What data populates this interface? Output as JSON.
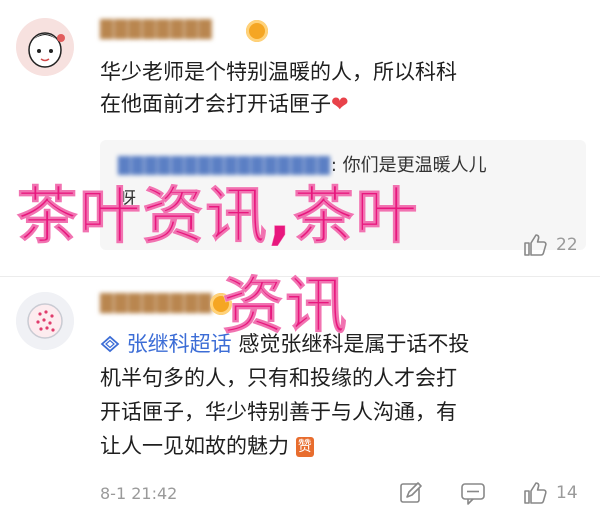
{
  "comment1": {
    "username": "████████",
    "text_line1": "华少老师是个特别温暖的人，所以科科",
    "text_line2": "在他面前才会打开话匣子",
    "heart": "❤",
    "quote_prefix": "████████████████",
    "quote_line1_suffix": ": 你们是更温暖人儿",
    "quote_line2": "呀",
    "like_count": "22"
  },
  "comment2": {
    "username": "████████",
    "link_label": "张继科超话",
    "text_line1_rest": " 感觉张继科是属于话不投",
    "text_line2": "机半句多的人，只有和投缘的人才会打",
    "text_line3": "开话匣子，华少特别善于与人沟通，有",
    "text_line4": "让人一见如故的魅力",
    "zan_emoji": "赞",
    "timestamp": "8-1 21:42",
    "like_count": "14"
  },
  "watermark": {
    "line1": "茶叶资讯,茶叶",
    "line2": "资讯"
  },
  "colors": {
    "watermark": "#e8177e",
    "link": "#3c6dd6",
    "heart": "#e8424a",
    "meta": "#9a9a9a"
  },
  "icons": [
    "edit-icon",
    "comment-icon",
    "like-icon",
    "chain-link-icon"
  ]
}
